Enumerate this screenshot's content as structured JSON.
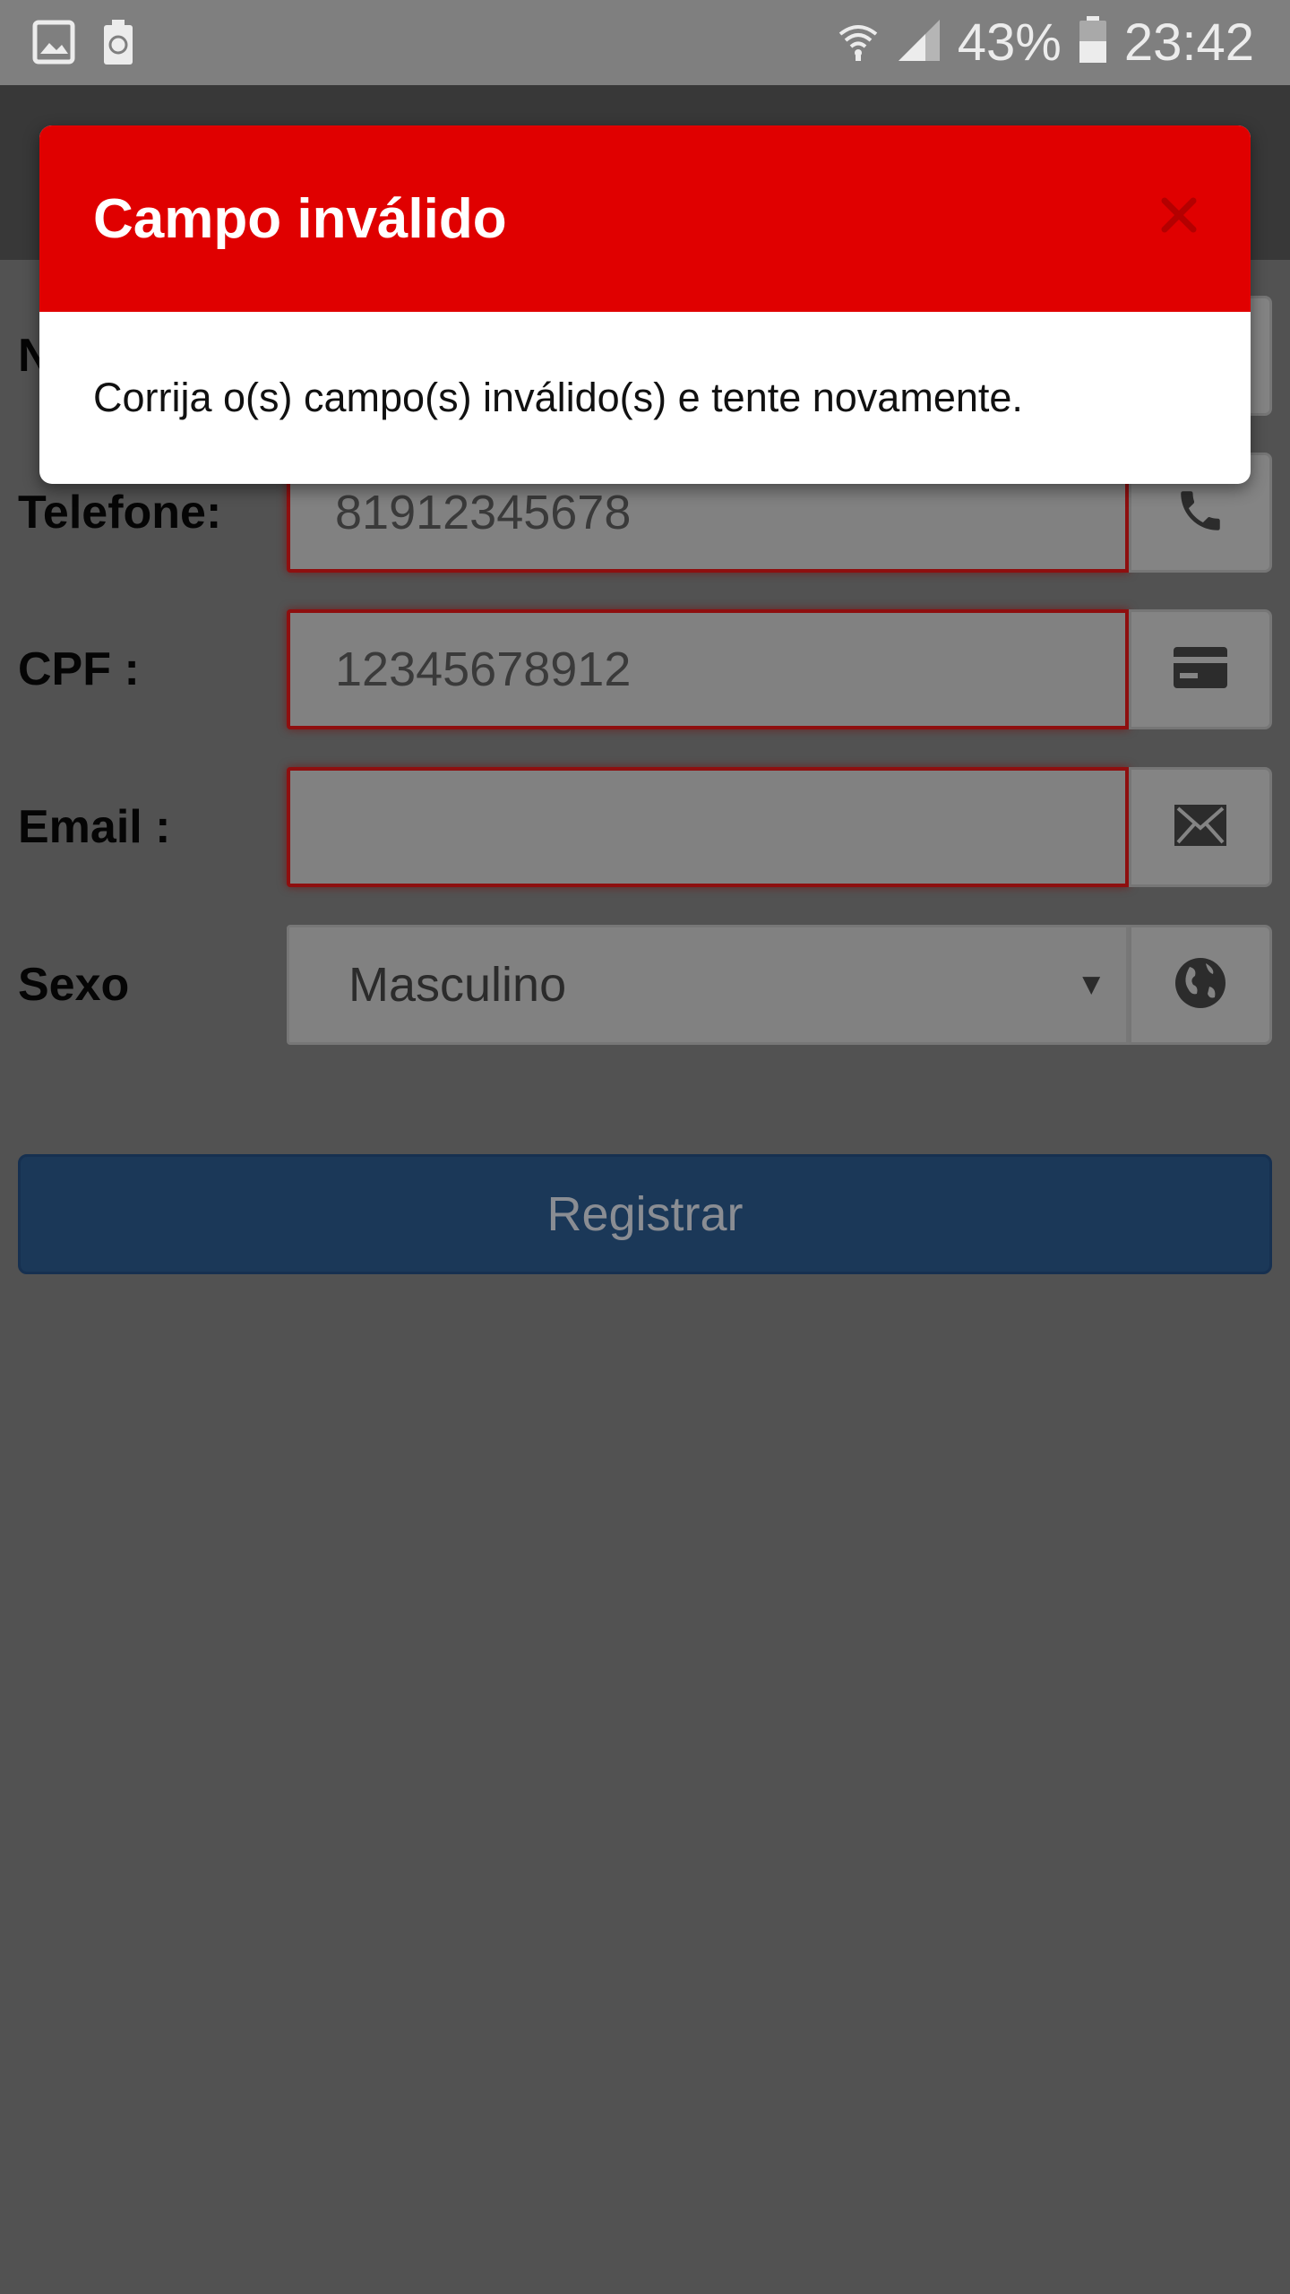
{
  "status_bar": {
    "battery_percent": "43%",
    "time": "23:42",
    "icons": [
      "image-icon",
      "recycle-battery-icon",
      "wifi-icon",
      "signal-icon",
      "battery-icon"
    ]
  },
  "form": {
    "name_label_partial": "N",
    "telefone": {
      "label": "Telefone:",
      "value": "81912345678",
      "icon": "phone-icon"
    },
    "cpf": {
      "label": "CPF :",
      "value": "12345678912",
      "icon": "card-icon"
    },
    "email": {
      "label": "Email :",
      "value": "",
      "icon": "envelope-icon"
    },
    "sexo": {
      "label": "Sexo",
      "selected": "Masculino",
      "arrow": "▼",
      "icon": "globe-icon"
    },
    "submit_label": "Registrar"
  },
  "modal": {
    "title": "Campo inválido",
    "message": "Corrija o(s) campo(s) inválido(s) e tente novamente.",
    "close_icon": "close-icon"
  },
  "colors": {
    "modal_header": "#e00000",
    "invalid_border": "#8e0f0f",
    "submit_bg": "#1b3858",
    "overlay_bg": "#525252"
  }
}
